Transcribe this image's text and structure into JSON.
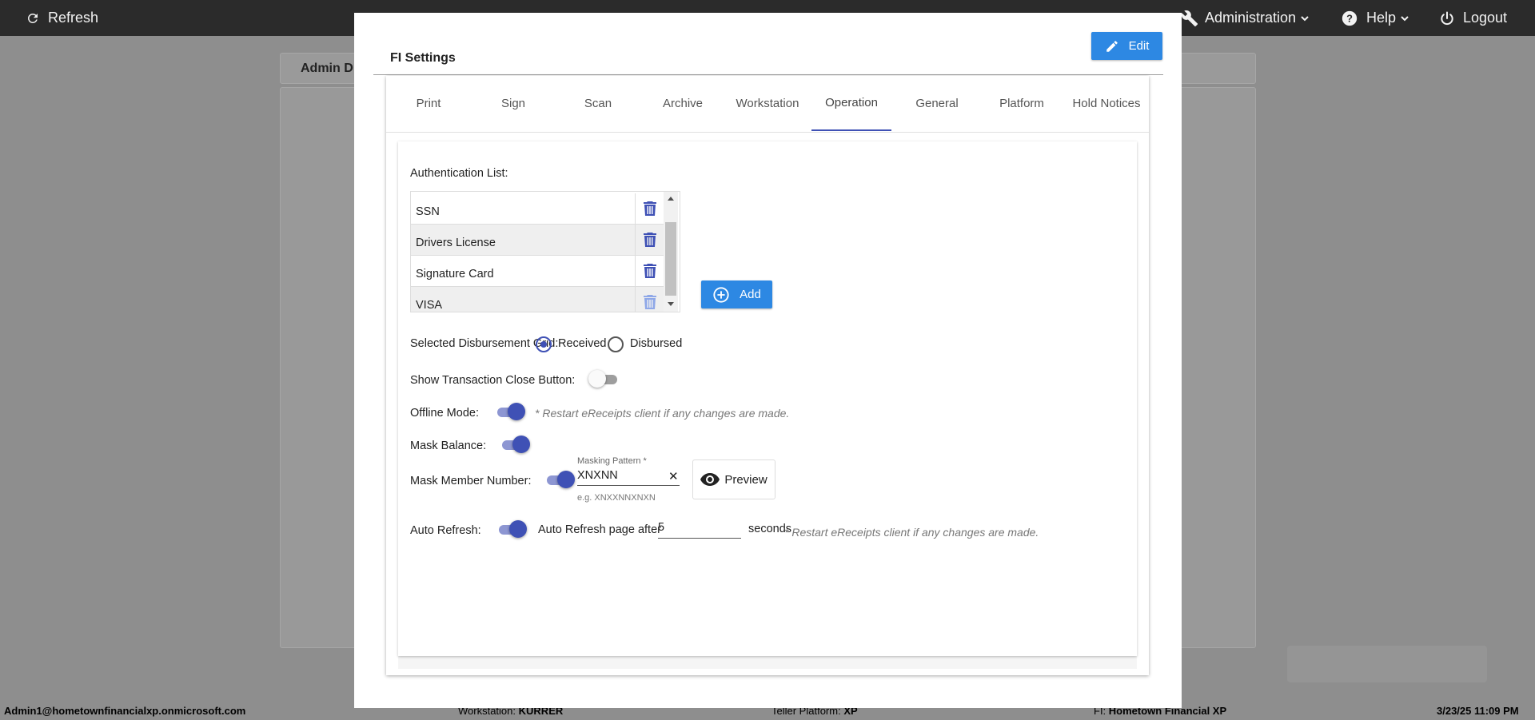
{
  "topbar": {
    "refresh_label": "Refresh",
    "administration_label": "Administration",
    "help_label": "Help",
    "logout_label": "Logout"
  },
  "background": {
    "header_title": "Admin D"
  },
  "statusbar": {
    "user": "Admin1@hometownfinancialxp.onmicrosoft.com",
    "workstation_label": "Workstation:",
    "workstation_value": "KURRER",
    "platform_label": "Teller Platform:",
    "platform_value": "XP",
    "fi_label": "FI:",
    "fi_value": "Hometown Financial XP",
    "datetime": "3/23/25 11:09 PM"
  },
  "modal": {
    "title": "FI Settings",
    "edit_label": "Edit",
    "tabs": [
      {
        "label": "Print"
      },
      {
        "label": "Sign"
      },
      {
        "label": "Scan"
      },
      {
        "label": "Archive"
      },
      {
        "label": "Workstation"
      },
      {
        "label": "Operation",
        "active": true
      },
      {
        "label": "General"
      },
      {
        "label": "Platform"
      },
      {
        "label": "Hold Notices"
      }
    ]
  },
  "operation": {
    "auth_list_label": "Authentication List:",
    "auth_items": [
      "SSN",
      "Drivers License",
      "Signature Card",
      "VISA"
    ],
    "add_label": "Add",
    "disbursement_label": "Selected Disbursement Grid:",
    "radio_received": "Received",
    "radio_disbursed": "Disbursed",
    "disbursement_selected": "Received",
    "show_close_label": "Show Transaction Close Button:",
    "show_close_on": false,
    "offline_label": "Offline Mode:",
    "offline_on": true,
    "offline_note": "* Restart eReceipts client if any changes are made.",
    "mask_balance_label": "Mask Balance:",
    "mask_balance_on": true,
    "mask_member_label": "Mask Member Number:",
    "mask_member_on": true,
    "masking_pattern_label": "Masking Pattern *",
    "masking_pattern_value": "XNXNN",
    "masking_pattern_hint": "e.g. XNXXNNXNXN",
    "preview_label": "Preview",
    "auto_refresh_label": "Auto Refresh:",
    "auto_refresh_on": true,
    "auto_refresh_text": "Auto Refresh page after",
    "auto_refresh_value": "5",
    "auto_refresh_unit": "seconds",
    "auto_refresh_note": "* Restart eReceipts client if any changes are made."
  },
  "colors": {
    "accent": "#3f51b5",
    "button_blue": "#2d88e3",
    "topbar": "#2b2b2b",
    "overlay": "#8e8e8e"
  }
}
